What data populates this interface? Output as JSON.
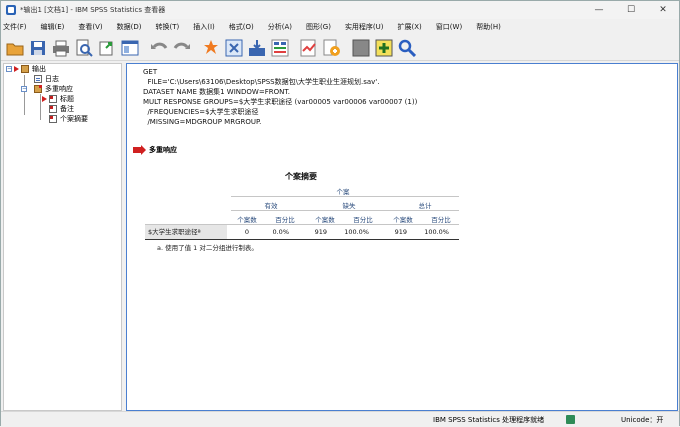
{
  "window": {
    "title": "*输出1 [文档1] - IBM SPSS Statistics 查看器",
    "controls": [
      "—",
      "☐",
      "✕"
    ]
  },
  "menu": [
    "文件(F)",
    "编辑(E)",
    "查看(V)",
    "数据(D)",
    "转换(T)",
    "插入(I)",
    "格式(O)",
    "分析(A)",
    "图形(G)",
    "实用程序(U)",
    "扩展(X)",
    "窗口(W)",
    "帮助(H)"
  ],
  "outline": {
    "root": "输出",
    "log": "日志",
    "proc": "多重响应",
    "children": [
      "标题",
      "备注",
      "个案摘要"
    ]
  },
  "syntax": "GET\n  FILE='C:\\Users\\63106\\Desktop\\SPSS数据包\\大学生职业生涯规划.sav'.\nDATASET NAME 数据集1 WINDOW=FRONT.\nMULT RESPONSE GROUPS=$大学生求职途径 (var00005 var00006 var00007 (1))\n  /FREQUENCIES=$大学生求职途径\n  /MISSING=MDGROUP MRGROUP.",
  "section_title": "多重响应",
  "table": {
    "title": "个案摘要",
    "group_header": "个案",
    "groups": [
      "有效",
      "缺失",
      "总计"
    ],
    "subheaders": [
      "个案数",
      "百分比",
      "个案数",
      "百分比",
      "个案数",
      "百分比"
    ],
    "row_label": "$大学生求职途径ª",
    "values": [
      "0",
      "0.0%",
      "919",
      "100.0%",
      "919",
      "100.0%"
    ],
    "footnote": "a. 使用了值 1 对二分组进行制表。"
  },
  "status": {
    "processor": "IBM SPSS Statistics 处理程序就绪",
    "unicode": "Unicode：开"
  }
}
